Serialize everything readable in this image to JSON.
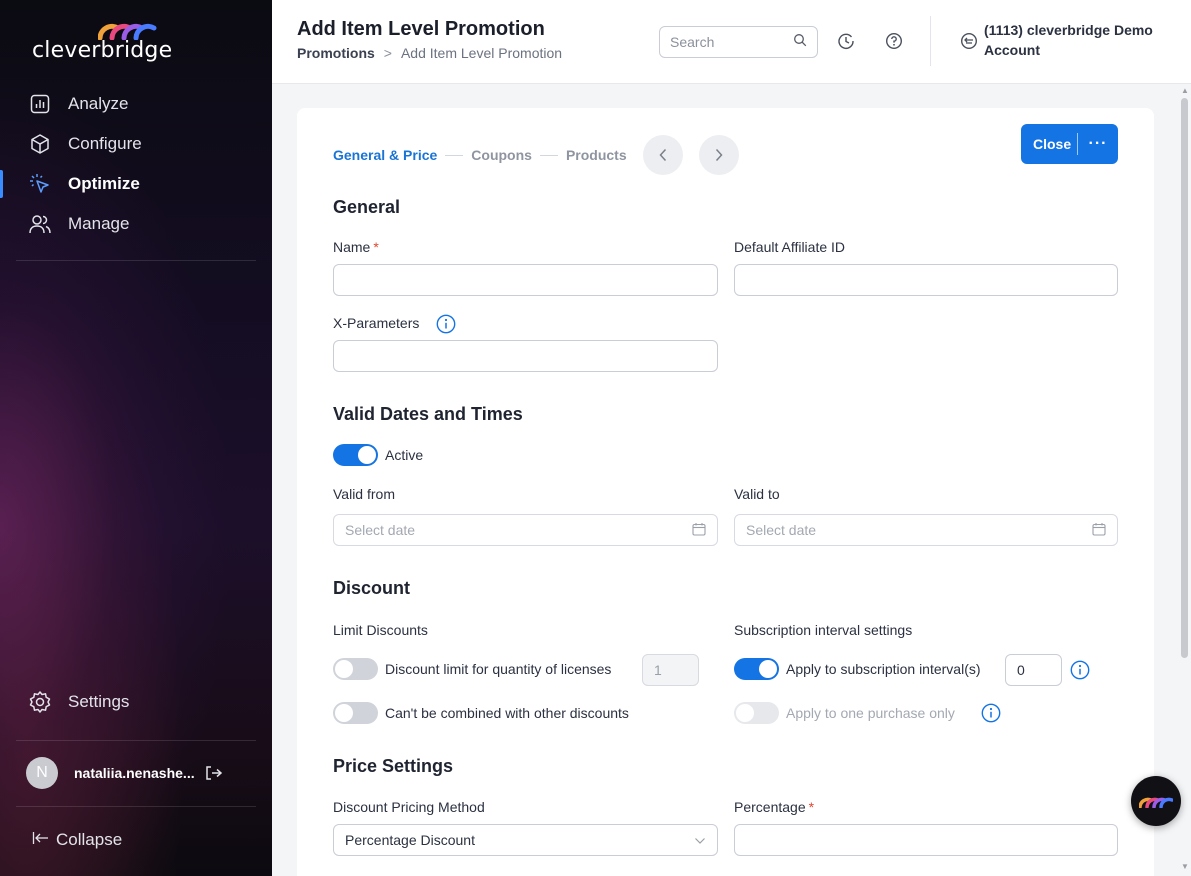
{
  "sidebar": {
    "logo_text": "cleverbridge",
    "nav": [
      {
        "label": "Analyze",
        "icon": "analyze-icon"
      },
      {
        "label": "Configure",
        "icon": "cube-icon"
      },
      {
        "label": "Optimize",
        "icon": "cursor-click-icon",
        "active": true
      },
      {
        "label": "Manage",
        "icon": "users-icon"
      }
    ],
    "settings_label": "Settings",
    "user": {
      "initial": "N",
      "name": "nataliia.nenashe..."
    },
    "collapse_label": "Collapse"
  },
  "header": {
    "title": "Add Item Level Promotion",
    "breadcrumb": {
      "root": "Promotions",
      "separator": ">",
      "current": "Add Item Level Promotion"
    },
    "search_placeholder": "Search",
    "account_label": "(1113) cleverbridge Demo Account"
  },
  "stepper": {
    "steps": [
      {
        "label": "General & Price",
        "active": true
      },
      {
        "label": "Coupons",
        "active": false
      },
      {
        "label": "Products",
        "active": false
      }
    ],
    "close_label": "Close",
    "more_label": "···"
  },
  "general": {
    "section_title": "General",
    "name_label": "Name",
    "name_value": "",
    "affiliate_label": "Default Affiliate ID",
    "affiliate_value": "",
    "xparams_label": "X-Parameters",
    "xparams_value": ""
  },
  "dates": {
    "section_title": "Valid Dates and Times",
    "active_label": "Active",
    "active_on": true,
    "valid_from_label": "Valid from",
    "valid_from_placeholder": "Select date",
    "valid_to_label": "Valid to",
    "valid_to_placeholder": "Select date"
  },
  "discount": {
    "section_title": "Discount",
    "limit_label": "Limit Discounts",
    "limit_quantity_label": "Discount limit for quantity of licenses",
    "limit_quantity_on": false,
    "limit_quantity_value": "1",
    "not_combined_label": "Can't be combined with other discounts",
    "not_combined_on": false,
    "subscription_label": "Subscription interval settings",
    "apply_interval_label": "Apply to subscription interval(s)",
    "apply_interval_on": true,
    "apply_interval_value": "0",
    "one_purchase_label": "Apply to one purchase only",
    "one_purchase_on": false
  },
  "price": {
    "section_title": "Price Settings",
    "method_label": "Discount Pricing Method",
    "method_value": "Percentage Discount",
    "percentage_label": "Percentage",
    "percentage_value": ""
  },
  "colors": {
    "accent": "#1574e3",
    "required": "#e2452f",
    "sidebar_bg": "#0b0b12"
  }
}
